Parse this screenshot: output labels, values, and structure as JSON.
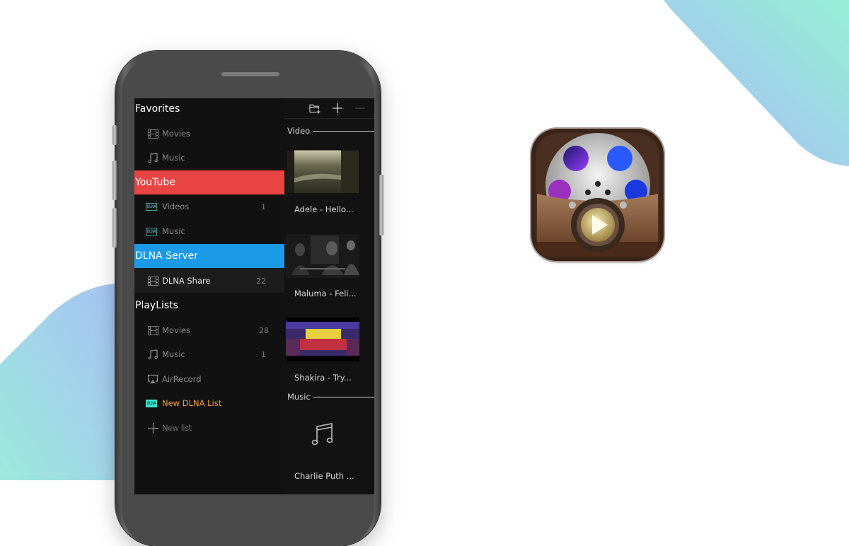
{
  "background": {
    "accent_gradient_start": "#a9bdf9",
    "accent_gradient_end": "#98efd6"
  },
  "phone": {
    "toolbar": {
      "icons": [
        "folder-add-icon",
        "plus-icon",
        "minus-icon"
      ]
    },
    "sidebar": {
      "favorites": {
        "title": "Favorites",
        "items": [
          {
            "icon": "film-icon",
            "label": "Movies",
            "count": ""
          },
          {
            "icon": "music-note-icon",
            "label": "Music",
            "count": ""
          }
        ]
      },
      "youtube": {
        "title": "YouTube",
        "color": "#e84444",
        "items": [
          {
            "icon": "dlna-icon",
            "badge": "DLNA",
            "label": "Videos",
            "count": "1"
          },
          {
            "icon": "dlna-icon",
            "badge": "DLNA",
            "label": "Music",
            "count": ""
          }
        ]
      },
      "dlna_server": {
        "title": "DLNA Server",
        "color": "#1b9ae8",
        "items": [
          {
            "icon": "film-icon",
            "label": "DLNA Share",
            "count": "22"
          }
        ]
      },
      "playlists": {
        "title": "PlayLists",
        "items": [
          {
            "icon": "film-icon",
            "label": "Movies",
            "count": "28"
          },
          {
            "icon": "music-note-icon",
            "label": "Music",
            "count": "1"
          },
          {
            "icon": "airplay-icon",
            "label": "AirRecord",
            "count": ""
          },
          {
            "icon": "dlna-icon",
            "badge": "DLNA",
            "label": "New DLNA List",
            "count": "",
            "color": "#f0a040"
          },
          {
            "icon": "plus-icon",
            "label": "New list",
            "count": ""
          }
        ]
      }
    },
    "content": {
      "video_section": "Video",
      "videos": [
        {
          "title": "Adele - Hello..."
        },
        {
          "title": "Maluma - Feli..."
        },
        {
          "title": "Shakira - Try..."
        }
      ],
      "music_section": "Music",
      "music": [
        {
          "title": "Charlie Puth ..."
        }
      ]
    }
  },
  "app_icon": {
    "name": "film-reel-play-app-icon"
  }
}
